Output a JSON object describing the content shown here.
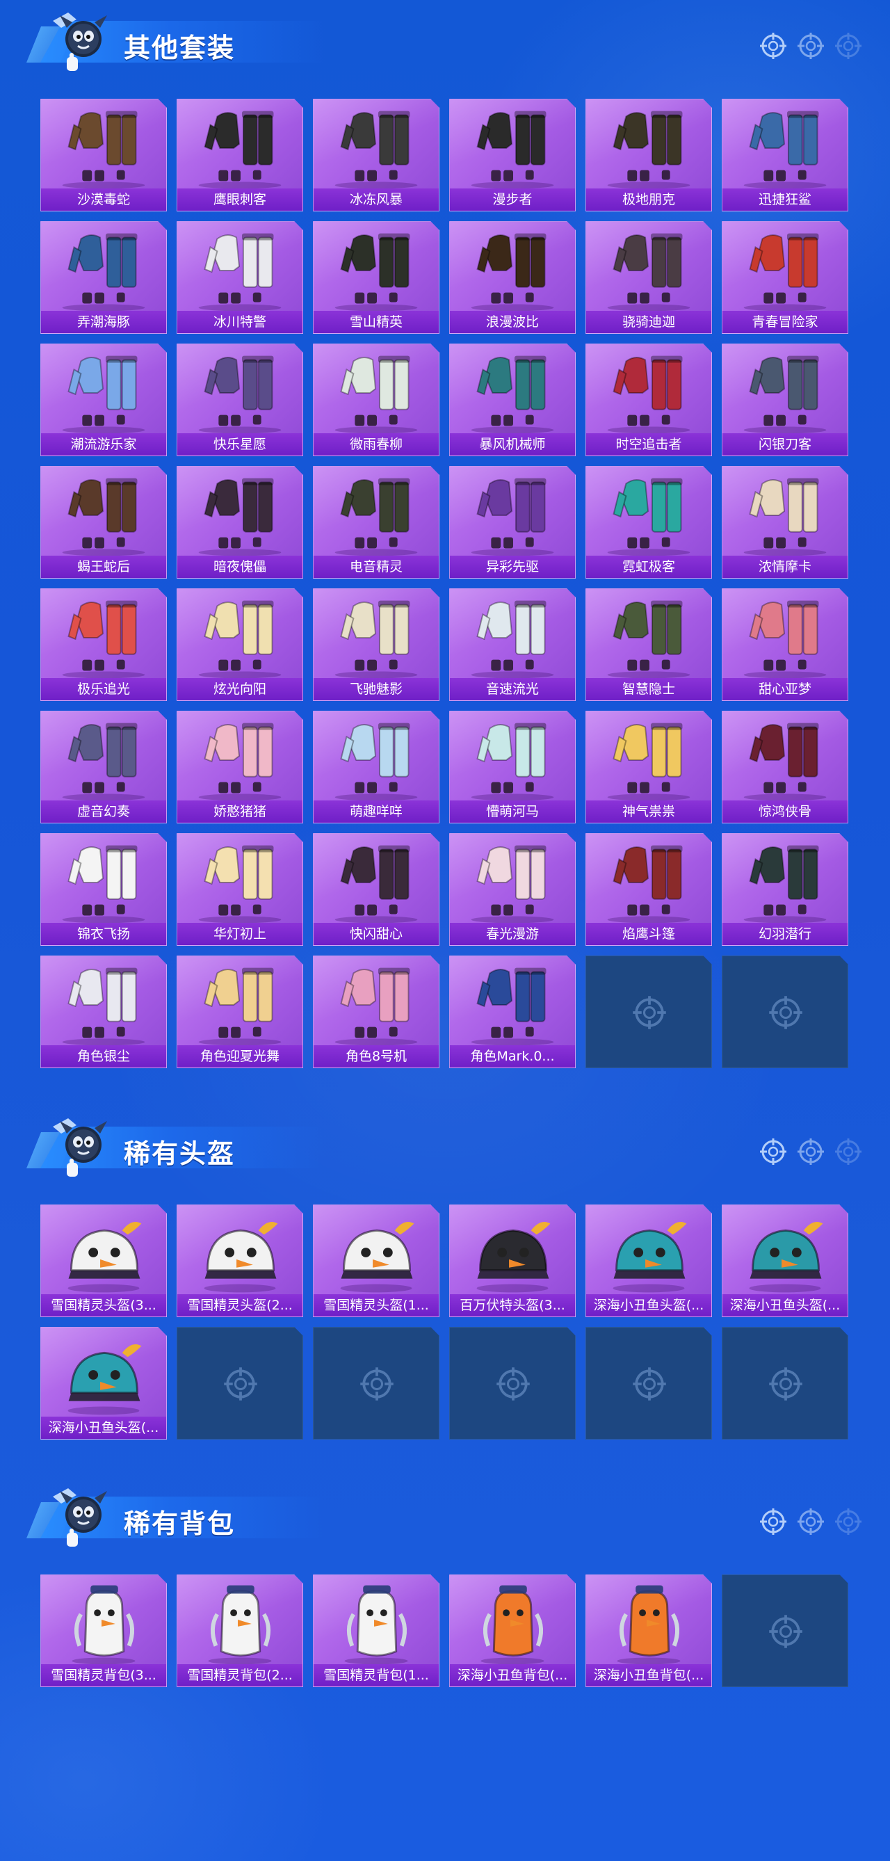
{
  "sections": [
    {
      "title": "其他套装",
      "kind": "outfit",
      "items": [
        {
          "label": "沙漠毒蛇",
          "color": "#6b4a2e"
        },
        {
          "label": "鹰眼刺客",
          "color": "#2b2b2b"
        },
        {
          "label": "冰冻风暴",
          "color": "#3a3a3a"
        },
        {
          "label": "漫步者",
          "color": "#2a2a2a"
        },
        {
          "label": "极地朋克",
          "color": "#3b3526"
        },
        {
          "label": "迅捷狂鲨",
          "color": "#3a6aa8"
        },
        {
          "label": "弄潮海豚",
          "color": "#2f5f9a"
        },
        {
          "label": "冰川特警",
          "color": "#e9e9ee"
        },
        {
          "label": "雪山精英",
          "color": "#2c3028"
        },
        {
          "label": "浪漫波比",
          "color": "#3b2818"
        },
        {
          "label": "骁骑迪迦",
          "color": "#4a3c44"
        },
        {
          "label": "青春冒险家",
          "color": "#c83a2e"
        },
        {
          "label": "潮流游乐家",
          "color": "#7aa8e8"
        },
        {
          "label": "快乐星愿",
          "color": "#5a4c8a"
        },
        {
          "label": "微雨春柳",
          "color": "#dfe8e0"
        },
        {
          "label": "暴风机械师",
          "color": "#2c7a80"
        },
        {
          "label": "时空追击者",
          "color": "#b02a3a"
        },
        {
          "label": "闪银刀客",
          "color": "#4a5870"
        },
        {
          "label": "蝎王蛇后",
          "color": "#5a3a2a"
        },
        {
          "label": "暗夜傀儡",
          "color": "#3a2a3c"
        },
        {
          "label": "电音精灵",
          "color": "#3a4030"
        },
        {
          "label": "异彩先驱",
          "color": "#6a3aa0"
        },
        {
          "label": "霓虹极客",
          "color": "#2aa8a0"
        },
        {
          "label": "浓情摩卡",
          "color": "#e8d8c0"
        },
        {
          "label": "极乐追光",
          "color": "#e0504a"
        },
        {
          "label": "炫光向阳",
          "color": "#f0e0b0"
        },
        {
          "label": "飞驰魅影",
          "color": "#e8e0c8"
        },
        {
          "label": "音速流光",
          "color": "#e0e8ee"
        },
        {
          "label": "智慧隐士",
          "color": "#4a5a3a"
        },
        {
          "label": "甜心亚梦",
          "color": "#e07a8a"
        },
        {
          "label": "虚音幻奏",
          "color": "#5a5a8a"
        },
        {
          "label": "娇憨猪猪",
          "color": "#f0b8c8"
        },
        {
          "label": "萌趣咩咩",
          "color": "#b8d8f0"
        },
        {
          "label": "懵萌河马",
          "color": "#c8e8e8"
        },
        {
          "label": "神气祟祟",
          "color": "#f0c860"
        },
        {
          "label": "惊鸿侠骨",
          "color": "#6a2030"
        },
        {
          "label": "锦衣飞扬",
          "color": "#f4f4f4"
        },
        {
          "label": "华灯初上",
          "color": "#f4e0b0"
        },
        {
          "label": "快闪甜心",
          "color": "#3a2a3a"
        },
        {
          "label": "春光漫游",
          "color": "#f0d8e0"
        },
        {
          "label": "焰鹰斗篷",
          "color": "#8a2a2a"
        },
        {
          "label": "幻羽潜行",
          "color": "#2a3a3a"
        },
        {
          "label": "角色银尘",
          "color": "#e8e8f0"
        },
        {
          "label": "角色迎夏光舞",
          "color": "#f0d090"
        },
        {
          "label": "角色8号机",
          "color": "#e8a0c0"
        },
        {
          "label": "角色Mark.0...",
          "color": "#2a4a9a"
        },
        {
          "empty": true
        },
        {
          "empty": true
        }
      ]
    },
    {
      "title": "稀有头盔",
      "kind": "helmet",
      "items": [
        {
          "label": "雪国精灵头盔(3...",
          "color": "#f2f2f2"
        },
        {
          "label": "雪国精灵头盔(2...",
          "color": "#f2f2f2"
        },
        {
          "label": "雪国精灵头盔(1...",
          "color": "#f2f2f2"
        },
        {
          "label": "百万伏特头盔(3...",
          "color": "#2a2a30"
        },
        {
          "label": "深海小丑鱼头盔(...",
          "color": "#2aa0b0"
        },
        {
          "label": "深海小丑鱼头盔(...",
          "color": "#2a9aa8"
        },
        {
          "label": "深海小丑鱼头盔(...",
          "color": "#2aa0b0"
        },
        {
          "empty": true
        },
        {
          "empty": true
        },
        {
          "empty": true
        },
        {
          "empty": true
        },
        {
          "empty": true
        }
      ]
    },
    {
      "title": "稀有背包",
      "kind": "backpack",
      "items": [
        {
          "label": "雪国精灵背包(3...",
          "color": "#f4f4f4"
        },
        {
          "label": "雪国精灵背包(2...",
          "color": "#f4f4f4"
        },
        {
          "label": "雪国精灵背包(1...",
          "color": "#f4f4f4"
        },
        {
          "label": "深海小丑鱼背包(...",
          "color": "#f07a2a"
        },
        {
          "label": "深海小丑鱼背包(...",
          "color": "#f07a2a"
        },
        {
          "empty": true
        }
      ]
    }
  ],
  "icons": {
    "section_mascot": "mascot-icon",
    "section_deco": "crosshair-icon",
    "empty_slot": "crosshair-icon"
  },
  "colors": {
    "background": "#1656d8",
    "card_purple": "#a85ee6",
    "label_purple": "#7a28cc",
    "empty_slot": "#1d4781"
  }
}
